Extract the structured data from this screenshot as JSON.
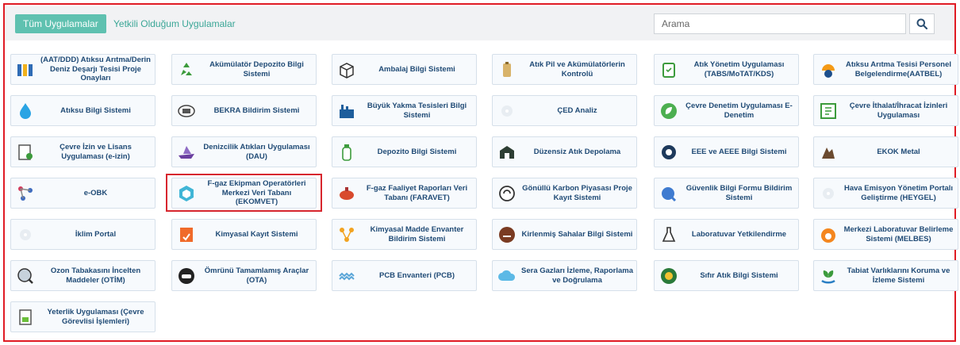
{
  "header": {
    "tab_all": "Tüm Uygulamalar",
    "tab_authorized": "Yetkili Olduğum Uygulamalar",
    "search_placeholder": "Arama"
  },
  "apps": [
    {
      "label": "(AAT/DDD) Atıksu Arıtma/Derin Deniz Deşarjı Tesisi Proje Onayları",
      "icon": "binders-icon"
    },
    {
      "label": "Akümülatör Depozito Bilgi Sistemi",
      "icon": "recycle-battery-icon"
    },
    {
      "label": "Ambalaj Bilgi Sistemi",
      "icon": "package-icon"
    },
    {
      "label": "Atık Pil ve Akümülatörlerin Kontrolü",
      "icon": "battery-icon"
    },
    {
      "label": "Atık Yönetim Uygulaması (TABS/MoTAT/KDS)",
      "icon": "trash-bin-icon"
    },
    {
      "label": "Atıksu Arıtma Tesisi Personel Belgelendirme(AATBEL)",
      "icon": "worker-helmet-icon"
    },
    {
      "label": "Atıksu Bilgi Sistemi",
      "icon": "water-drop-icon"
    },
    {
      "label": "BEKRA Bildirim Sistemi",
      "icon": "bekra-badge-icon"
    },
    {
      "label": "Büyük Yakma Tesisleri Bilgi Sistemi",
      "icon": "factory-icon"
    },
    {
      "label": "ÇED Analiz",
      "icon": "placeholder-icon"
    },
    {
      "label": "Çevre Denetim Uygulaması E-Denetim",
      "icon": "leaf-circle-icon"
    },
    {
      "label": "Çevre İthalat/İhracat İzinleri Uygulaması",
      "icon": "document-box-icon"
    },
    {
      "label": "Çevre İzin ve Lisans Uygulaması (e-izin)",
      "icon": "certificate-icon"
    },
    {
      "label": "Denizcilik Atıkları Uygulaması (DAU)",
      "icon": "ship-icon"
    },
    {
      "label": "Depozito Bilgi Sistemi",
      "icon": "bottle-icon"
    },
    {
      "label": "Düzensiz Atık Depolama",
      "icon": "landfill-icon"
    },
    {
      "label": "EEE ve AEEE Bilgi Sistemi",
      "icon": "electronics-icon"
    },
    {
      "label": "EKOK Metal",
      "icon": "metal-scrap-icon"
    },
    {
      "label": "e-OBK",
      "icon": "molecule-icon"
    },
    {
      "label": "F-gaz Ekipman Operatörleri Merkezi Veri Tabanı (EKOMVET)",
      "icon": "hexagon-icon"
    },
    {
      "label": "F-gaz Faaliyet Raporları Veri Tabanı (FARAVET)",
      "icon": "gas-cylinder-icon"
    },
    {
      "label": "Gönüllü Karbon Piyasası Proje Kayıt Sistemi",
      "icon": "carbon-cycle-icon"
    },
    {
      "label": "Güvenlik Bilgi Formu Bildirim Sistemi",
      "icon": "safety-form-icon"
    },
    {
      "label": "Hava Emisyon Yönetim Portalı Geliştirme (HEYGEL)",
      "icon": "placeholder-icon"
    },
    {
      "label": "İklim Portal",
      "icon": "placeholder-icon"
    },
    {
      "label": "Kimyasal Kayıt Sistemi",
      "icon": "chemical-doc-icon"
    },
    {
      "label": "Kimyasal Madde Envanter Bildirim Sistemi",
      "icon": "chemical-network-icon"
    },
    {
      "label": "Kirlenmiş Sahalar Bilgi Sistemi",
      "icon": "polluted-site-icon"
    },
    {
      "label": "Laboratuvar Yetkilendirme",
      "icon": "flask-icon"
    },
    {
      "label": "Merkezi Laboratuvar Belirleme Sistemi (MELBES)",
      "icon": "lab-helmet-icon"
    },
    {
      "label": "Ozon Tabakasını İncelten Maddeler (OTİM)",
      "icon": "ozone-search-icon"
    },
    {
      "label": "Ömrünü Tamamlamış Araçlar (OTA)",
      "icon": "car-icon"
    },
    {
      "label": "PCB Envanteri (PCB)",
      "icon": "pcb-chain-icon"
    },
    {
      "label": "Sera Gazları İzleme, Raporlama ve Doğrulama",
      "icon": "cloud-icon"
    },
    {
      "label": "Sıfır Atık Bilgi Sistemi",
      "icon": "zero-waste-icon"
    },
    {
      "label": "Tabiat Varlıklarını Koruma ve İzleme Sistemi",
      "icon": "plant-hand-icon"
    },
    {
      "label": "Yeterlik Uygulaması (Çevre Görevlisi İşlemleri)",
      "icon": "report-doc-icon"
    }
  ],
  "highlighted_app": "F-gaz Ekipman Operatörleri Merkezi Veri Tabanı (EKOMVET)",
  "colors": {
    "accent_teal": "#5fc1b0",
    "link_teal": "#3aa696",
    "label_blue": "#1f4a75",
    "frame_red": "#e01b24"
  }
}
